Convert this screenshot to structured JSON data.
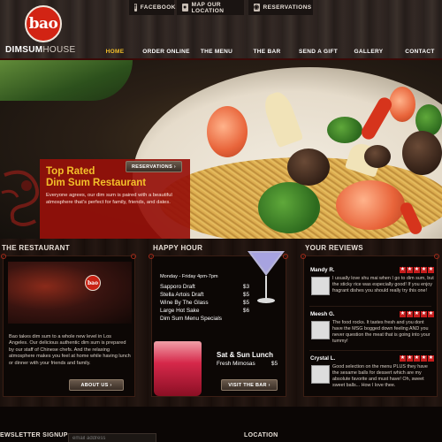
{
  "brand": {
    "logo": "bao",
    "name_bold": "DIMSUM",
    "name_light": "HOUSE",
    "accent": "#d22414"
  },
  "utility": [
    {
      "label": "FACEBOOK",
      "icon": "f"
    },
    {
      "label": "MAP OUR LOCATION",
      "icon": "⬤"
    },
    {
      "label": "RESERVATIONS",
      "icon": "◉"
    }
  ],
  "nav": [
    "HOME",
    "ORDER ONLINE",
    "THE MENU",
    "THE BAR",
    "SEND A GIFT",
    "GALLERY",
    "CONTACT"
  ],
  "promo": {
    "title_line1": "Top Rated",
    "title_line2": "Dim Sum Restaurant",
    "text": "Everyone agrees, our dim sum is paired with a beautiful atmosphere that’s perfect for family, friends, and dates.",
    "button": "RESERVATIONS ›"
  },
  "restaurant": {
    "heading": "THE RESTAURANT",
    "logo": "bao",
    "text": "Bao takes dim sum to a whole new level in Los Angeles. Our delicious authentic dim sum is prepared by our staff of Chinese chefs. And the relaxing atmosphere makes you feel at home while having lunch or dinner with your friends and family.",
    "button": "ABOUT US ›"
  },
  "happy_hour": {
    "heading": "HAPPY HOUR",
    "hours": "Monday - Friday 4pm-7pm",
    "items": [
      {
        "name": "Sapporo Draft",
        "price": "$3"
      },
      {
        "name": "Stella Artois Draft",
        "price": "$5"
      },
      {
        "name": "Wine By The Glass",
        "price": "$5"
      },
      {
        "name": "Large Hot Sake",
        "price": "$6"
      },
      {
        "name": "Dim Sum Menu Specials",
        "price": ""
      }
    ],
    "special_title": "Sat & Sun Lunch",
    "special_item": "Fresh Mimosas",
    "special_price": "$5",
    "button": "VISIT THE BAR ›"
  },
  "reviews": {
    "heading": "YOUR REVIEWS",
    "items": [
      {
        "name": "Mandy R.",
        "text": "I usually love shu mai when I go to dim sum, but the sticky rice was especially good! If you enjoy fragrant dishes you should really try this one!"
      },
      {
        "name": "Meesh G.",
        "text": "The food rocks. It tastes fresh and you dont have the MSG bogged down feeling AND you never question the meat that is going into your tummy!"
      },
      {
        "name": "Crystal L.",
        "text": "Good selection on the menu PLUS they have the sesame balls for dessert which are my absolute favorite and must have! Oh, sweet sweet balls... How I love thee."
      }
    ]
  },
  "footer": {
    "newsletter": "EWSLETTER SIGNUP",
    "email_placeholder": "email address",
    "location": "LOCATION"
  }
}
